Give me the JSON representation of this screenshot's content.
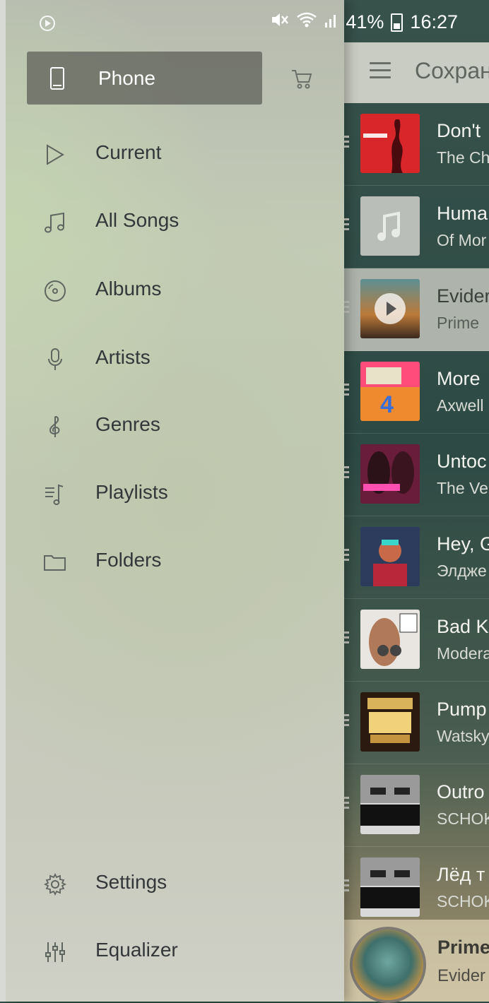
{
  "status_bar": {
    "battery": "41%",
    "time": "16:27",
    "icons": [
      "media-play-icon",
      "mute-icon",
      "wifi-icon",
      "signal-icon",
      "battery-icon"
    ]
  },
  "background": {
    "header_title": "Сохран",
    "songs": [
      {
        "title": "Don't",
        "artist": "The Ch",
        "art_icon": "album-chainsmokers-art"
      },
      {
        "title": "Huma",
        "artist": "Of Mor",
        "art_icon": "music-note-placeholder-art"
      },
      {
        "title": "Evider",
        "artist": "Prime",
        "art_icon": "album-prime-circle-art"
      },
      {
        "title": "More",
        "artist": "Axwell",
        "art_icon": "album-now-4-art"
      },
      {
        "title": "Untoc",
        "artist": "The Ve",
        "art_icon": "album-veronicas-art"
      },
      {
        "title": "Hey, G",
        "artist": "Элдже",
        "art_icon": "album-eldzhey-art"
      },
      {
        "title": "Bad K",
        "artist": "Modera",
        "art_icon": "album-hit-list-2015-art"
      },
      {
        "title": "Pump",
        "artist": "Watsky",
        "art_icon": "album-party-hits-art"
      },
      {
        "title": "Outro",
        "artist": "SCHOK",
        "art_icon": "album-para-schokk-art"
      },
      {
        "title": "Лёд т",
        "artist": "SCHOK",
        "art_icon": "album-para-schokk-art"
      }
    ],
    "now_playing": {
      "title": "Prime",
      "subtitle": "Evider"
    }
  },
  "drawer": {
    "source": {
      "label": "Phone",
      "icon": "phone-icon"
    },
    "store_icon": "cart-icon",
    "items": [
      {
        "label": "Current",
        "icon": "play-triangle-icon"
      },
      {
        "label": "All Songs",
        "icon": "music-note-icon"
      },
      {
        "label": "Albums",
        "icon": "disc-icon"
      },
      {
        "label": "Artists",
        "icon": "microphone-icon"
      },
      {
        "label": "Genres",
        "icon": "treble-clef-icon"
      },
      {
        "label": "Playlists",
        "icon": "playlist-icon"
      },
      {
        "label": "Folders",
        "icon": "folder-icon"
      }
    ],
    "bottom_items": [
      {
        "label": "Settings",
        "icon": "gear-icon"
      },
      {
        "label": "Equalizer",
        "icon": "equalizer-icon"
      }
    ]
  }
}
